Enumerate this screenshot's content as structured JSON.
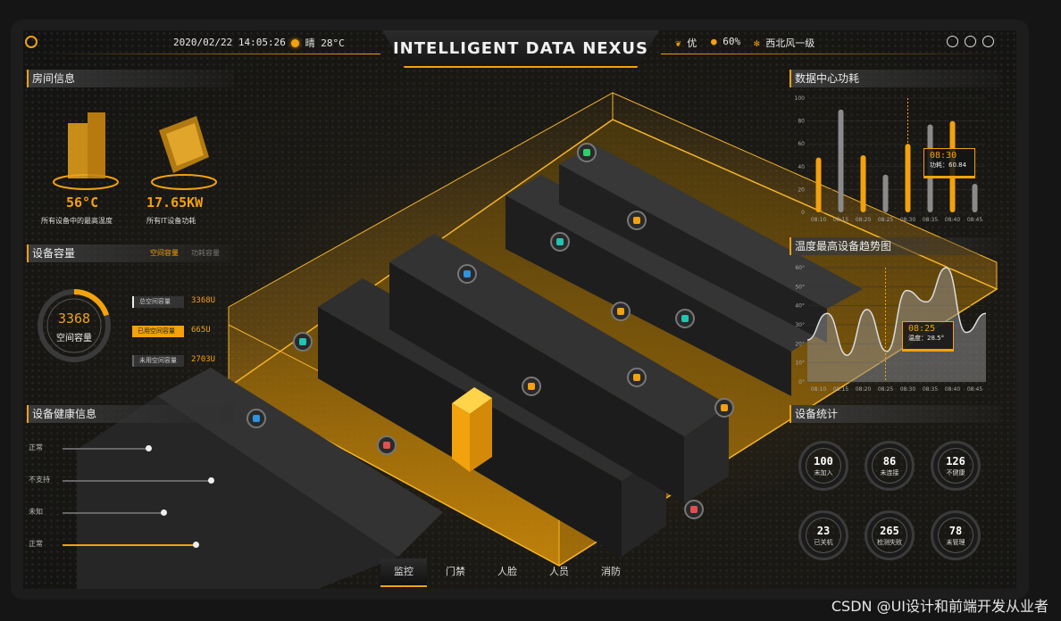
{
  "header": {
    "datetime": "2020/02/22  14:05:26",
    "weather": "晴 28°C",
    "title": "INTELLIGENT DATA NEXUS",
    "air": "优",
    "humidity": "60%",
    "wind": "西北风一级"
  },
  "room_info": {
    "title": "房间信息",
    "max_temp_value": "56°C",
    "max_temp_label": "所有设备中的最高温度",
    "power_value": "17.65KW",
    "power_label": "所有IT设备功耗"
  },
  "capacity": {
    "title": "设备容量",
    "tab_space": "空间容量",
    "tab_power": "功耗容量",
    "center_value": "3368",
    "center_label": "空间容量",
    "ratio_used": 0.2,
    "total_label": "总空间容量",
    "total_value": "3368U",
    "used_label": "已用空间容量",
    "used_value": "665U",
    "free_label": "未用空间容量",
    "free_value": "2703U"
  },
  "health": {
    "title": "设备健康信息",
    "items": [
      {
        "label": "正常",
        "level": 0.55
      },
      {
        "label": "不支持",
        "level": 0.95
      },
      {
        "label": "未知",
        "level": 0.65
      },
      {
        "label": "正常",
        "level": 0.85
      }
    ]
  },
  "power_chart": {
    "title": "数据中心功耗",
    "chart_data": {
      "type": "bar",
      "categories": [
        "08:10",
        "08:15",
        "08:20",
        "08:25",
        "08:30",
        "08:35",
        "08:40",
        "08:45"
      ],
      "series": [
        {
          "values": [
            48,
            0,
            50,
            0,
            60,
            0,
            80,
            0
          ]
        },
        {
          "values": [
            0,
            90,
            0,
            33,
            0,
            77,
            0,
            25
          ]
        }
      ],
      "ylim": [
        0,
        100
      ],
      "yticks": [
        0,
        20,
        40,
        60,
        80,
        100
      ],
      "tooltip_time": "08:30",
      "tooltip_text": "功耗：60.84"
    }
  },
  "temp_chart": {
    "title": "温度最高设备趋势图",
    "chart_data": {
      "type": "area",
      "x": [
        "08:10",
        "08:15",
        "08:20",
        "08:25",
        "08:30",
        "08:35",
        "08:40",
        "08:45"
      ],
      "values": [
        22,
        36,
        14,
        38,
        16,
        48,
        42,
        60,
        26,
        36
      ],
      "ylim": [
        0,
        60
      ],
      "yticks": [
        "0°",
        "10°",
        "20°",
        "30°",
        "40°",
        "50°",
        "60°"
      ],
      "tooltip_time": "08:25",
      "tooltip_text": "温度：28.5°"
    }
  },
  "stats": {
    "title": "设备统计",
    "items": [
      {
        "value": "100",
        "label": "未加入"
      },
      {
        "value": "86",
        "label": "未连接"
      },
      {
        "value": "126",
        "label": "不健康"
      },
      {
        "value": "23",
        "label": "已关机"
      },
      {
        "value": "265",
        "label": "检测失败"
      },
      {
        "value": "78",
        "label": "未管理"
      }
    ]
  },
  "tabs": [
    "监控",
    "门禁",
    "人脸",
    "人员",
    "消防"
  ],
  "watermark": "CSDN @UI设计和前端开发从业者",
  "colors": {
    "accent": "#f2a20c",
    "bg": "#151515"
  }
}
